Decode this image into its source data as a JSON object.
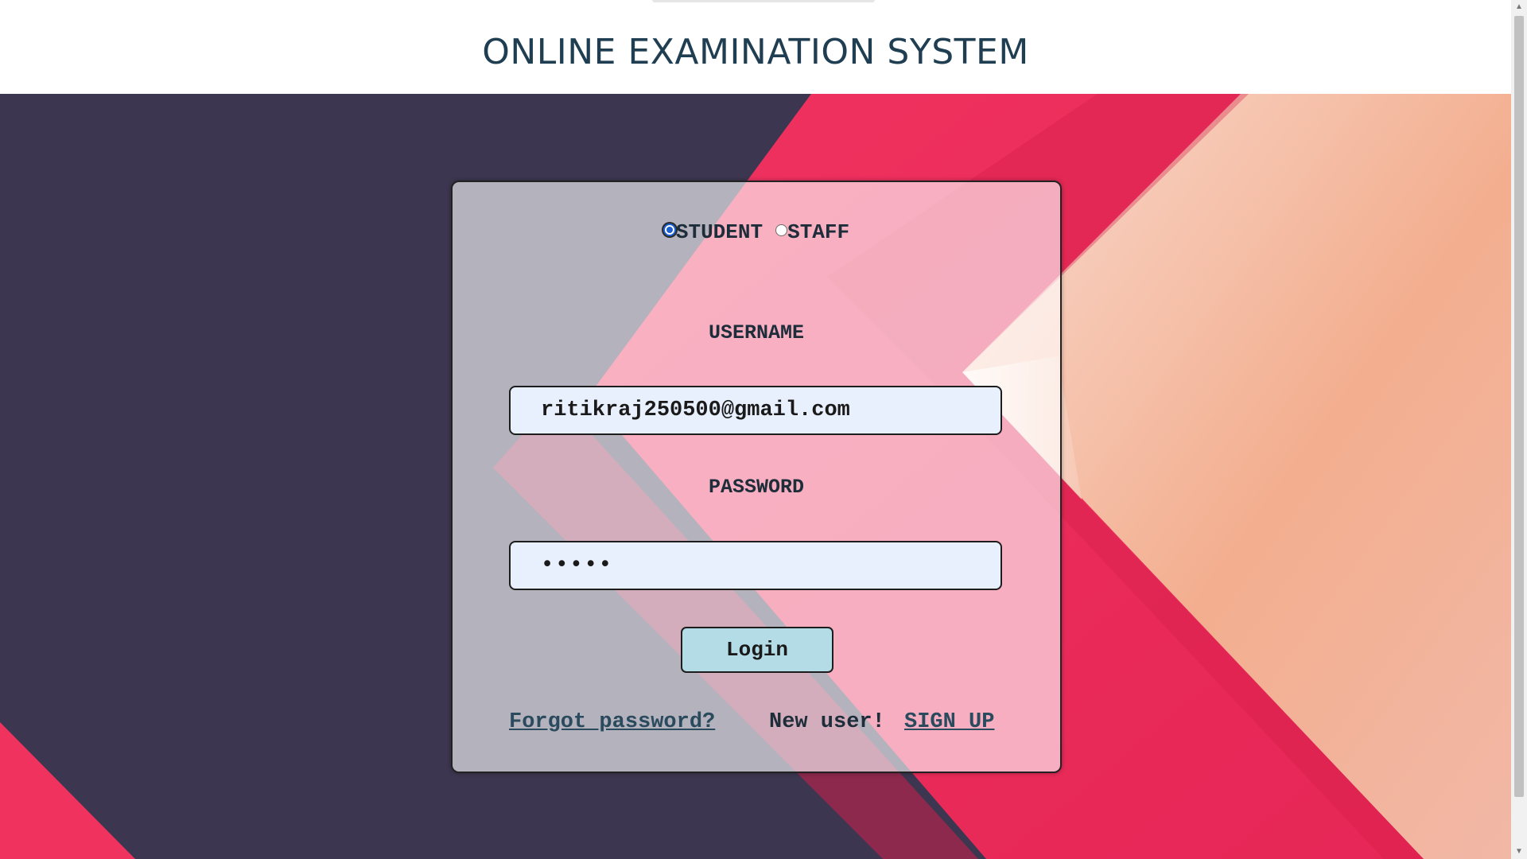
{
  "header": {
    "title": "ONLINE EXAMINATION SYSTEM"
  },
  "login": {
    "roles": [
      {
        "label": "STUDENT",
        "selected": true
      },
      {
        "label": "STAFF",
        "selected": false
      }
    ],
    "username_label": "USERNAME",
    "username_value": "ritikraj250500@gmail.com",
    "password_label": "PASSWORD",
    "password_value": "•••••",
    "login_button": "Login",
    "forgot_link": "Forgot password?",
    "new_user_text": "New user!",
    "signup_link": "SIGN UP"
  },
  "colors": {
    "background_dark": "#3c3650",
    "accent_pink": "#ee2d5c",
    "accent_peach": "#f4b393",
    "button_bg": "#b3dce6",
    "title_color": "#1f3e52"
  }
}
